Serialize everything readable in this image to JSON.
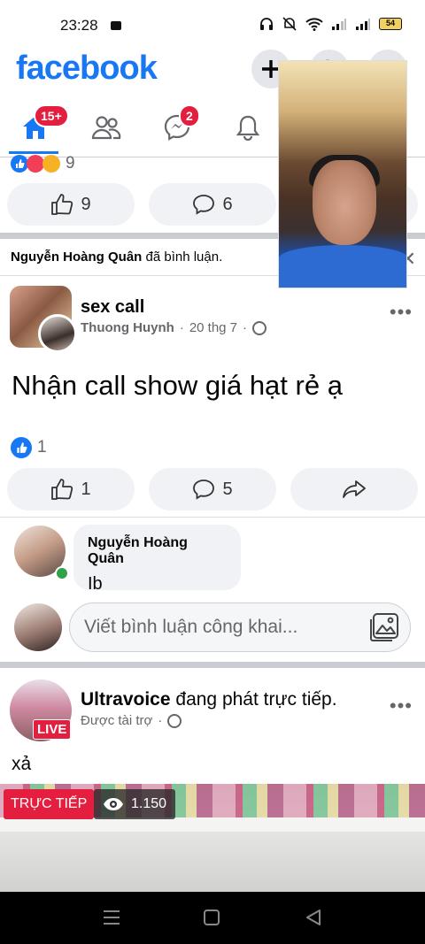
{
  "status_bar": {
    "time": "23:28",
    "battery": "54"
  },
  "header": {
    "logo": "facebook",
    "buttons": [
      {
        "icon": "plus-icon"
      },
      {
        "icon": "search-icon"
      },
      {
        "icon": "menu-icon"
      }
    ]
  },
  "nav": {
    "home_badge": "15+",
    "messenger_badge": "2",
    "items": [
      "home-icon",
      "friends-icon",
      "messenger-icon",
      "bell-icon"
    ]
  },
  "prev_post": {
    "reaction_count": "9",
    "like_count": "9",
    "comment_count": "6"
  },
  "notice": {
    "author": "Nguyễn Hoàng Quân",
    "action": "đã bình luận."
  },
  "post": {
    "group_name": "sex call",
    "author": "Thuong Huynh",
    "date": "20 thg 7",
    "separator": "·",
    "more": "•••",
    "text": "Nhận call show giá hạt rẻ ạ",
    "reaction_count": "1",
    "like_count": "1",
    "comment_count": "5"
  },
  "comment": {
    "author": "Nguyễn Hoàng Quân",
    "text": "Ib"
  },
  "comment_input": {
    "placeholder": "Viết bình luận công khai..."
  },
  "sponsored": {
    "page": "Ultravoice",
    "action": "đang phát trực tiếp.",
    "sub": "Được tài trợ",
    "live_badge": "LIVE",
    "more": "•••",
    "text": "xả",
    "live_tag": "TRỰC TIẾP",
    "views": "1.150"
  },
  "colors": {
    "brand": "#1877f2",
    "badge": "#e41e3f",
    "online": "#31a24c"
  }
}
